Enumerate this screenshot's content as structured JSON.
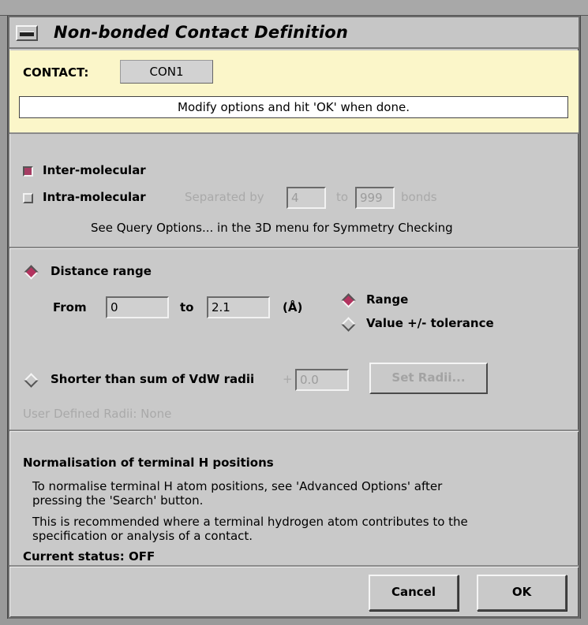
{
  "window": {
    "title": "Non-bonded Contact Definition"
  },
  "contact": {
    "label": "CONTACT:",
    "value": "CON1"
  },
  "message": "Modify options and hit 'OK' when done.",
  "molecular": {
    "inter_label": "Inter-molecular",
    "inter_checked": true,
    "intra_label": "Intra-molecular",
    "intra_checked": false,
    "separated_by": "Separated by",
    "min_bonds": "4",
    "to": "to",
    "max_bonds": "999",
    "bonds": "bonds",
    "symmetry_note": "See Query Options... in the 3D menu for Symmetry Checking"
  },
  "distance": {
    "radio_label": "Distance range",
    "selected": true,
    "from_label": "From",
    "from_value": "0",
    "to_label": "to",
    "to_value": "2.1",
    "unit": "(Å)",
    "mode_range": "Range",
    "mode_tolerance": "Value +/- tolerance",
    "mode_selected": "Range"
  },
  "vdw": {
    "radio_label": "Shorter than sum of VdW radii",
    "selected": false,
    "plus": "+",
    "value": "0.0",
    "set_radii_button": "Set Radii...",
    "user_defined": "User Defined Radii:  None"
  },
  "normalisation": {
    "heading": "Normalisation of terminal H positions",
    "para1_line1": "To normalise terminal H atom positions, see 'Advanced Options' after",
    "para1_line2": "pressing the 'Search' button.",
    "para2_line1": "This is recommended where a terminal hydrogen atom contributes to the",
    "para2_line2": "specification or analysis of a contact.",
    "status": "Current status: OFF"
  },
  "buttons": {
    "cancel": "Cancel",
    "ok": "OK"
  },
  "colors": {
    "accent": "#a63c63",
    "info_panel": "#fbf6c9",
    "window_bg": "#c9c9c9"
  }
}
